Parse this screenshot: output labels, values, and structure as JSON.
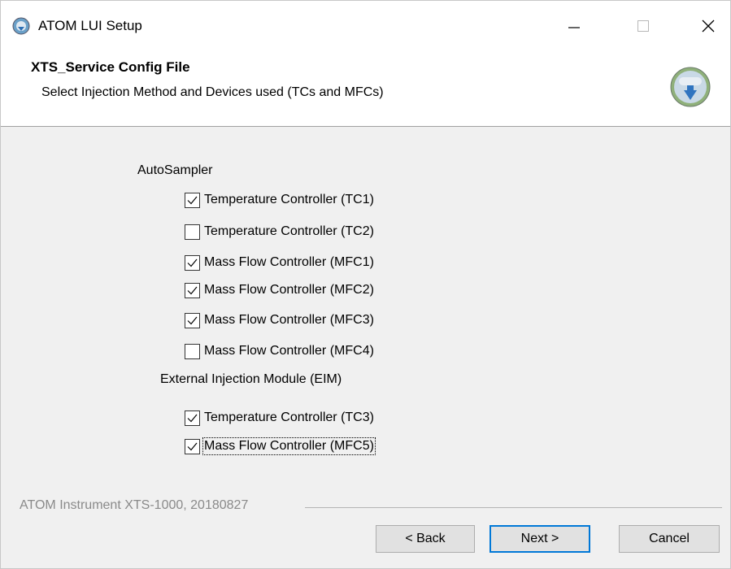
{
  "window": {
    "title": "ATOM LUI Setup",
    "controls": {
      "minimize_icon": "minimize-icon",
      "maximize_icon": "maximize-icon",
      "close_icon": "close-icon"
    }
  },
  "header": {
    "title": "XTS_Service Config File",
    "subtitle": "Select Injection Method and Devices used (TCs and MFCs)"
  },
  "groups": [
    {
      "label": "AutoSampler",
      "items": [
        {
          "label": "Temperature Controller (TC1)",
          "checked": true
        },
        {
          "label": "Temperature Controller (TC2)",
          "checked": false
        },
        {
          "label": "Mass Flow Controller (MFC1)",
          "checked": true
        },
        {
          "label": "Mass Flow Controller (MFC2)",
          "checked": true
        },
        {
          "label": "Mass Flow Controller (MFC3)",
          "checked": true
        },
        {
          "label": "Mass Flow Controller (MFC4)",
          "checked": false
        }
      ]
    },
    {
      "label": "External Injection Module (EIM)",
      "items": [
        {
          "label": "Temperature Controller (TC3)",
          "checked": true
        },
        {
          "label": "Mass Flow Controller (MFC5)",
          "checked": true
        }
      ]
    }
  ],
  "footer": {
    "brand_text": "ATOM Instrument XTS-1000, 20180827",
    "back_label": "< Back",
    "next_label": "Next >",
    "cancel_label": "Cancel"
  },
  "colors": {
    "accent": "#0078d7",
    "dialog_bg": "#f0f0f0",
    "footer_text": "#8a8a8a"
  }
}
